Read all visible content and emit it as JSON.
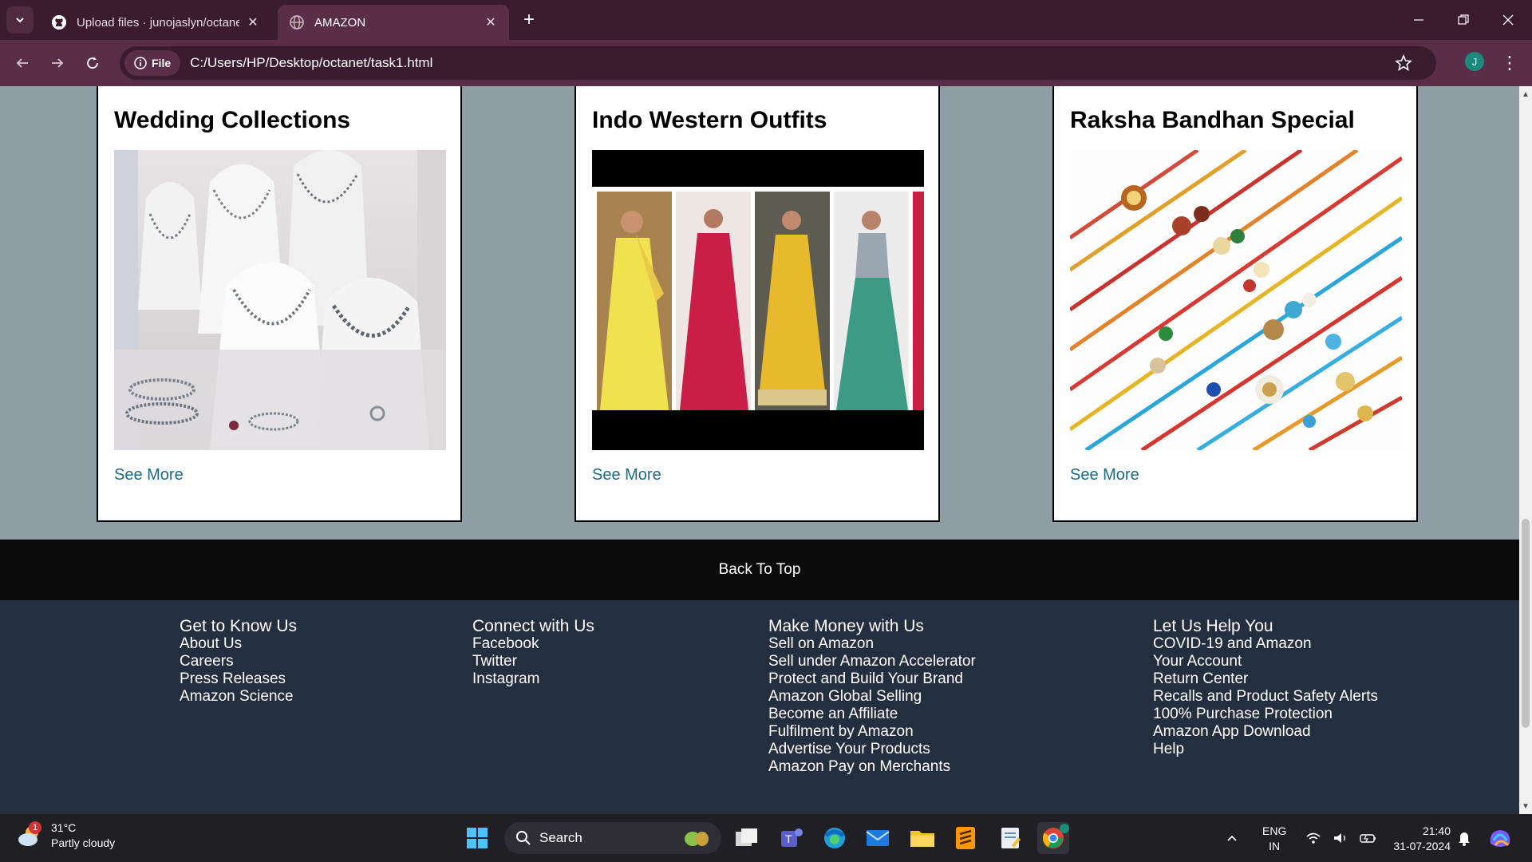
{
  "browser": {
    "tabs": [
      {
        "title": "Upload files · junojaslyn/octane",
        "favicon": "github-icon"
      },
      {
        "title": "AMAZON",
        "favicon": "globe-icon"
      }
    ],
    "address": {
      "chip": "File",
      "url": "C:/Users/HP/Desktop/octanet/task1.html"
    },
    "profile_initial": "J"
  },
  "cards": [
    {
      "title": "Wedding Collections",
      "link": "See More"
    },
    {
      "title": "Indo Western Outfits",
      "link": "See More"
    },
    {
      "title": "Raksha Bandhan Special",
      "link": "See More"
    }
  ],
  "back_to_top": "Back To Top",
  "footer": {
    "col1": {
      "heading": "Get to Know Us",
      "links": [
        "About Us",
        "Careers",
        "Press Releases",
        "Amazon Science"
      ]
    },
    "col2": {
      "heading": "Connect with Us",
      "links": [
        "Facebook",
        "Twitter",
        "Instagram"
      ]
    },
    "col3": {
      "heading": "Make Money with Us",
      "links": [
        "Sell on Amazon",
        "Sell under Amazon Accelerator",
        "Protect and Build Your Brand",
        "Amazon Global Selling",
        "Become an Affiliate",
        "Fulfilment by Amazon",
        "Advertise Your Products",
        "Amazon Pay on Merchants"
      ]
    },
    "col4": {
      "heading": "Let Us Help You",
      "links": [
        "COVID-19 and Amazon",
        "Your Account",
        "Return Center",
        "Recalls and Product Safety Alerts",
        "100% Purchase Protection",
        "Amazon App Download",
        "Help"
      ]
    }
  },
  "taskbar": {
    "weather": {
      "temp": "31°C",
      "condition": "Partly cloudy",
      "badge": "1"
    },
    "search_label": "Search",
    "language": {
      "line1": "ENG",
      "line2": "IN"
    },
    "clock": {
      "time": "21:40",
      "date": "31-07-2024"
    }
  },
  "colors": {
    "page_bg": "#8f9ea4",
    "footer_bg": "#232f3e",
    "link": "#1a6b85",
    "chrome": "#5a2e49"
  }
}
